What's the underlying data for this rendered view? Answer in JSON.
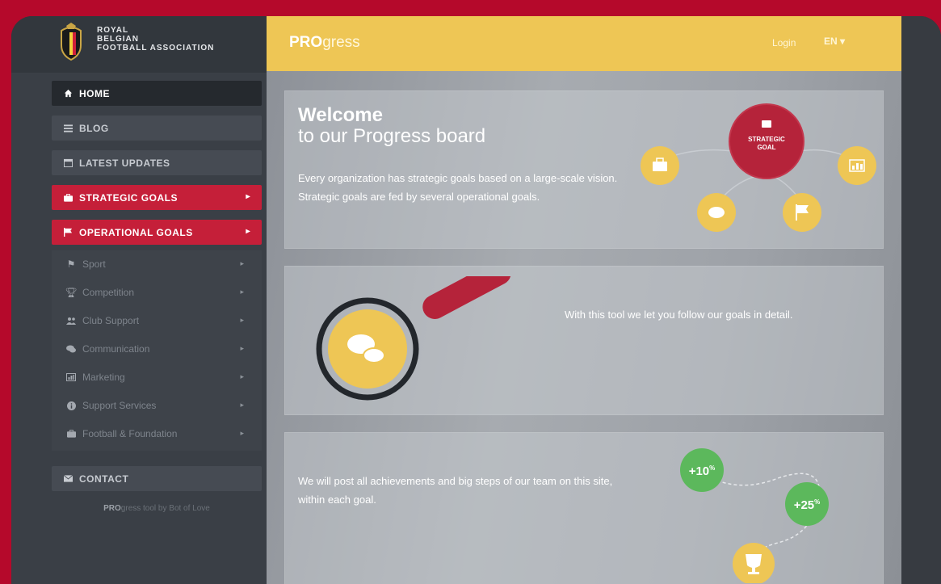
{
  "brand": {
    "line1": "ROYAL",
    "line2": "BELGIAN",
    "line3": "FOOTBALL ASSOCIATION"
  },
  "topbar": {
    "logo_bold": "PRO",
    "logo_rest": "gress",
    "login": "Login",
    "lang": "EN ▾"
  },
  "nav": {
    "home": "HOME",
    "blog": "BLOG",
    "latest_updates": "LATEST UPDATES",
    "strategic_goals": "STRATEGIC GOALS",
    "operational_goals": "OPERATIONAL GOALS",
    "sub": [
      {
        "label": "Sport",
        "icon": "flag-icon"
      },
      {
        "label": "Competition",
        "icon": "trophy-icon"
      },
      {
        "label": "Club Support",
        "icon": "users-icon"
      },
      {
        "label": "Communication",
        "icon": "comments-icon"
      },
      {
        "label": "Marketing",
        "icon": "chart-icon"
      },
      {
        "label": "Support Services",
        "icon": "info-icon"
      },
      {
        "label": "Football & Foundation",
        "icon": "briefcase-icon"
      }
    ],
    "contact": "CONTACT",
    "footer_bold": "PRO",
    "footer_rest": "gress tool by Bot of Love"
  },
  "welcome": {
    "title": "Welcome",
    "subtitle": "to our Progress board",
    "text": "Every organization has strategic goals based on a large-scale vision. Strategic goals are fed by several operational goals.",
    "diagram_center_line1": "STRATEGIC",
    "diagram_center_line2": "GOAL"
  },
  "tool": {
    "text": "With this tool we let you follow our goals in detail."
  },
  "achievements": {
    "text": "We will post all achievements and big steps of our team on this site, within each goal.",
    "badge1": "+10",
    "badge2": "+25",
    "badge_unit": "%"
  },
  "colors": {
    "accent_red": "#c51f39",
    "accent_yellow": "#eec655",
    "green": "#5cb85c"
  }
}
